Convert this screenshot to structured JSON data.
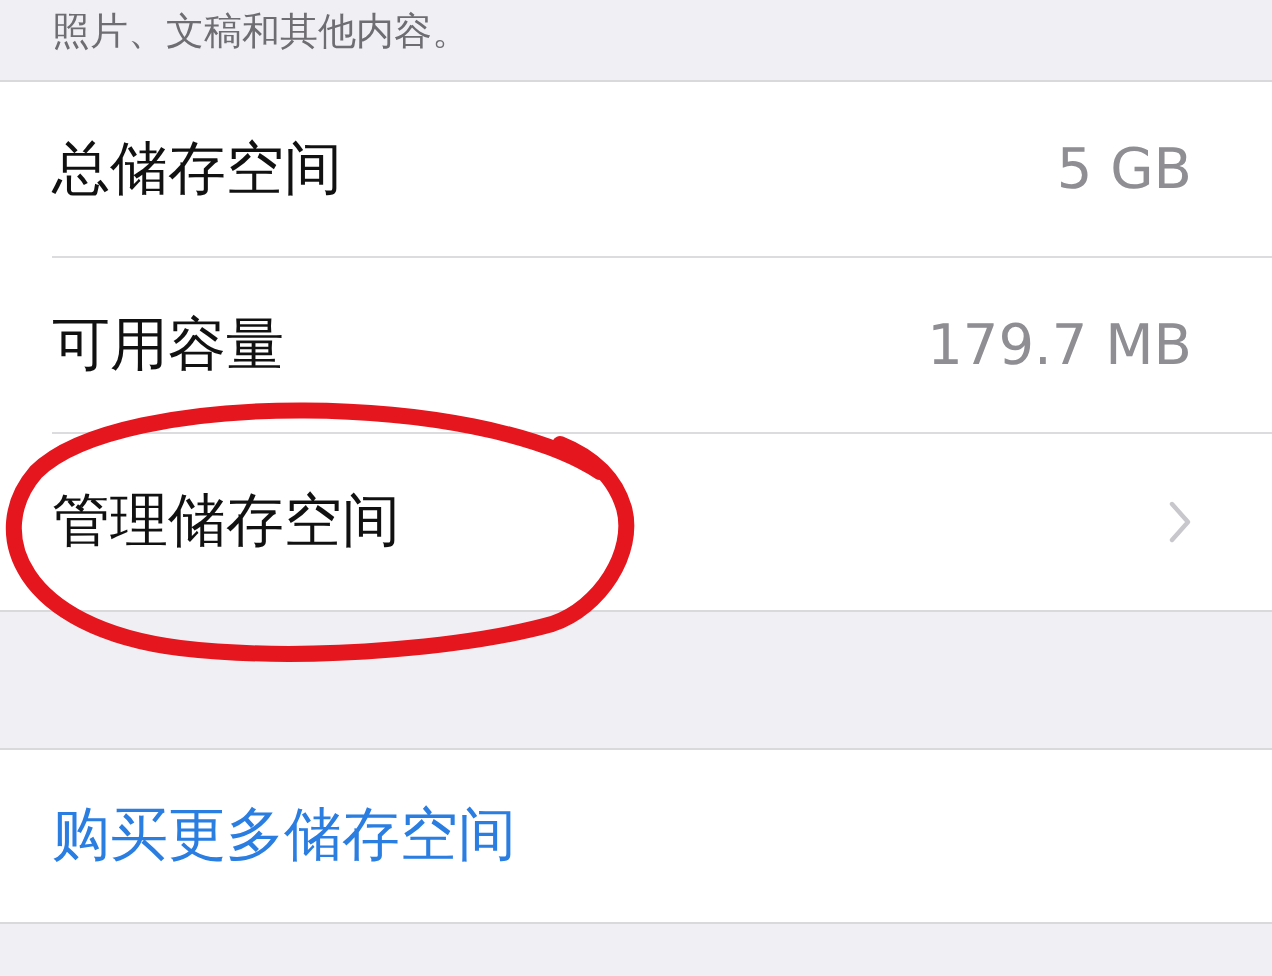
{
  "section_footer": "照片、文稿和其他内容。",
  "storage_rows": [
    {
      "kind": "value",
      "label": "总储存空间",
      "value": "5 GB"
    },
    {
      "kind": "value",
      "label": "可用容量",
      "value": "179.7 MB"
    },
    {
      "kind": "link",
      "label": "管理储存空间"
    }
  ],
  "buy_button": "购买更多储存空间",
  "annotation": {
    "kind": "circle"
  }
}
